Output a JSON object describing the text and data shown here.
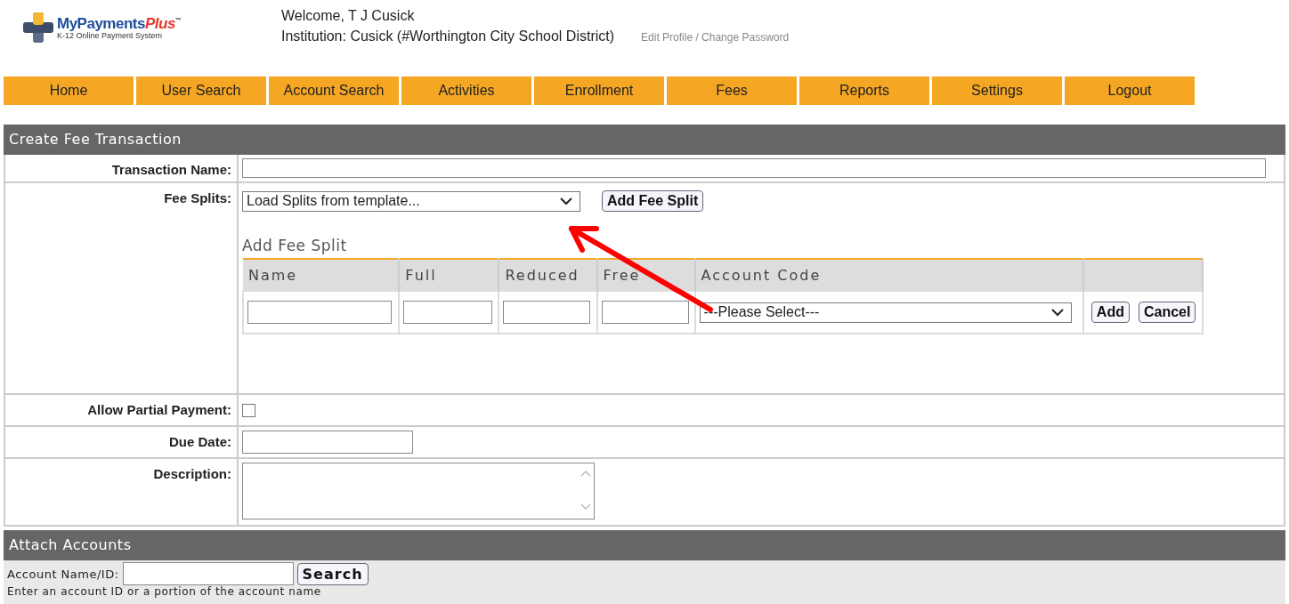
{
  "header": {
    "logo": {
      "name": "MyPayments",
      "name_accent": "Plus",
      "trademark": "™",
      "tagline": "K-12 Online Payment System"
    },
    "welcome": "Welcome, T J Cusick",
    "institution": "Institution: Cusick (#Worthington City School District)",
    "profile_link": "Edit Profile / Change Password"
  },
  "nav": [
    {
      "label": "Home"
    },
    {
      "label": "User Search"
    },
    {
      "label": "Account Search"
    },
    {
      "label": "Activities"
    },
    {
      "label": "Enrollment"
    },
    {
      "label": "Fees"
    },
    {
      "label": "Reports"
    },
    {
      "label": "Settings"
    },
    {
      "label": "Logout"
    }
  ],
  "create_section": {
    "title": "Create Fee Transaction",
    "transaction_name": {
      "label": "Transaction Name:"
    },
    "fee_splits": {
      "label": "Fee Splits:",
      "template_select": "Load Splits from template...",
      "add_button": "Add Fee Split",
      "panel_title": "Add Fee Split",
      "columns": [
        "Name",
        "Full",
        "Reduced",
        "Free",
        "Account Code"
      ],
      "account_select": "---Please Select---",
      "row_buttons": [
        "Add",
        "Cancel"
      ]
    },
    "partial_payment": {
      "label": "Allow Partial Payment:",
      "checked": false
    },
    "due_date": {
      "label": "Due Date:"
    },
    "description": {
      "label": "Description:"
    }
  },
  "attach_section": {
    "title": "Attach Accounts",
    "search_label": "Account Name/ID:",
    "search_button": "Search",
    "hint": "Enter an account ID or a portion of the account name"
  }
}
